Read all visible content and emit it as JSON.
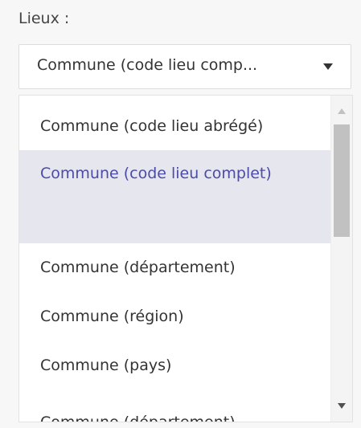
{
  "field": {
    "label": "Lieux :"
  },
  "select": {
    "value": "Commune (code lieu comp..."
  },
  "dropdown": {
    "options": [
      {
        "label": "Commune (code lieu abrégé)"
      },
      {
        "label": "Commune (code lieu complet)",
        "selected": true
      },
      {
        "label": "Commune (département)"
      },
      {
        "label": "Commune (région)"
      },
      {
        "label": "Commune (pays)"
      },
      {
        "label": "Commune (département)"
      }
    ]
  },
  "colors": {
    "selected_background": "#e6e6ee",
    "selected_text": "#4b4ba8",
    "text": "#333333"
  },
  "icons": {
    "caret": "chevron-down-icon",
    "scroll_up": "scroll-up-arrow-icon",
    "scroll_down": "scroll-down-arrow-icon"
  }
}
